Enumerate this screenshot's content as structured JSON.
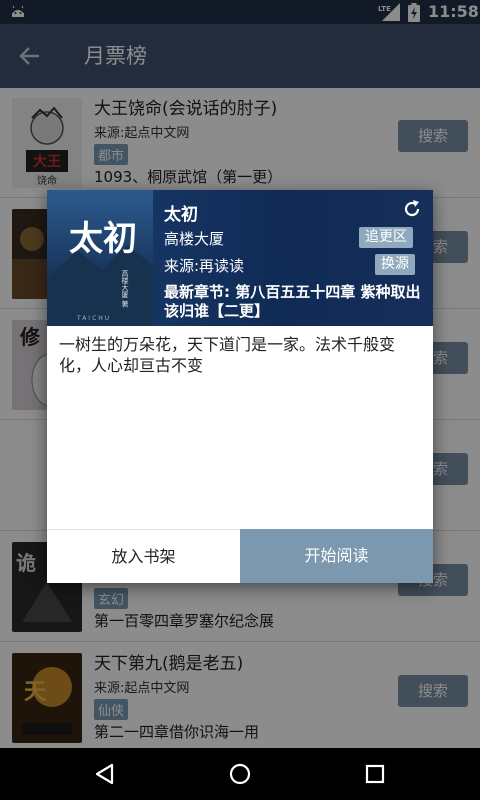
{
  "status_bar": {
    "time": "11:58",
    "network": "LTE"
  },
  "app_bar": {
    "title": "月票榜",
    "back_icon": "arrow-left-icon"
  },
  "books": [
    {
      "title": "大王饶命(会说话的肘子)",
      "source": "来源:起点中文网",
      "tag": "都市",
      "latest": "1093、桐原武馆（第一更）",
      "search_label": "搜索",
      "cover_color": "#e8e8e8"
    },
    {
      "title": "",
      "source": "",
      "tag": "",
      "latest": "",
      "search_label": "搜索",
      "cover_color": "#4a3a2a"
    },
    {
      "title": "",
      "source": "",
      "tag": "",
      "latest": "",
      "search_label": "搜索",
      "cover_color": "#c8c0c8"
    },
    {
      "title": "",
      "source": "",
      "tag": "",
      "latest": "",
      "search_label": "搜索",
      "cover_color": "#ffffff"
    },
    {
      "title": "",
      "source": "",
      "tag": "玄幻",
      "latest": "第一百零四章罗塞尔纪念展",
      "search_label": "搜索",
      "cover_color": "#3a3a3a"
    },
    {
      "title": "天下第九(鹅是老五)",
      "source": "来源:起点中文网",
      "tag": "仙侠",
      "latest": "第二一四章借你识海一用",
      "search_label": "搜索",
      "cover_color": "#5a3a1a"
    }
  ],
  "dialog": {
    "title": "太初",
    "author": "高楼大厦",
    "follow_label": "追更区",
    "source": "来源:再读读",
    "change_source_label": "换源",
    "latest": "最新章节: 第八百五五十四章 紫种取出该归谁【二更】",
    "intro": "一树生的万朵花，天下道门是一家。法术千般变化，人心却亘古不变",
    "add_shelf_label": "放入书架",
    "start_read_label": "开始阅读",
    "cover": {
      "big_title": "太初",
      "small_text": "高楼大厦 著",
      "pinyin": "TAICHU"
    }
  },
  "colors": {
    "status_bar": "#22304a",
    "app_bar": "#3f5170",
    "accent": "#7c98ae",
    "tag": "#7a9ab4"
  },
  "nav_bar": {
    "back_icon": "triangle-back-icon",
    "home_icon": "circle-home-icon",
    "recent_icon": "square-recents-icon"
  }
}
